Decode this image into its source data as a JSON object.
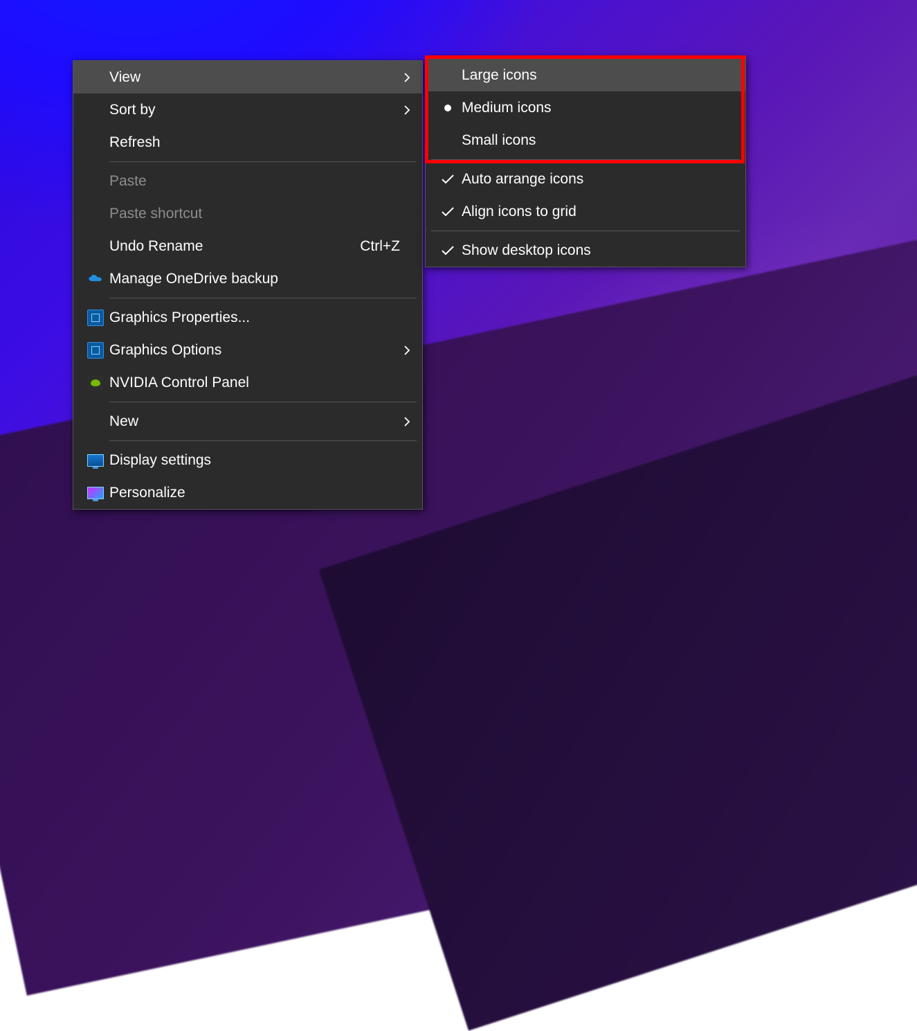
{
  "main_menu": {
    "view": {
      "label": "View"
    },
    "sort_by": {
      "label": "Sort by"
    },
    "refresh": {
      "label": "Refresh"
    },
    "paste": {
      "label": "Paste"
    },
    "paste_shortcut": {
      "label": "Paste shortcut"
    },
    "undo_rename": {
      "label": "Undo Rename",
      "shortcut": "Ctrl+Z"
    },
    "manage_onedrive": {
      "label": "Manage OneDrive backup"
    },
    "graphics_properties": {
      "label": "Graphics Properties..."
    },
    "graphics_options": {
      "label": "Graphics Options"
    },
    "nvidia_control_panel": {
      "label": "NVIDIA Control Panel"
    },
    "new": {
      "label": "New"
    },
    "display_settings": {
      "label": "Display settings"
    },
    "personalize": {
      "label": "Personalize"
    }
  },
  "submenu": {
    "large_icons": {
      "label": "Large icons"
    },
    "medium_icons": {
      "label": "Medium icons"
    },
    "small_icons": {
      "label": "Small icons"
    },
    "auto_arrange": {
      "label": "Auto arrange icons"
    },
    "align_to_grid": {
      "label": "Align icons to grid"
    },
    "show_desktop_icons": {
      "label": "Show desktop icons"
    }
  }
}
